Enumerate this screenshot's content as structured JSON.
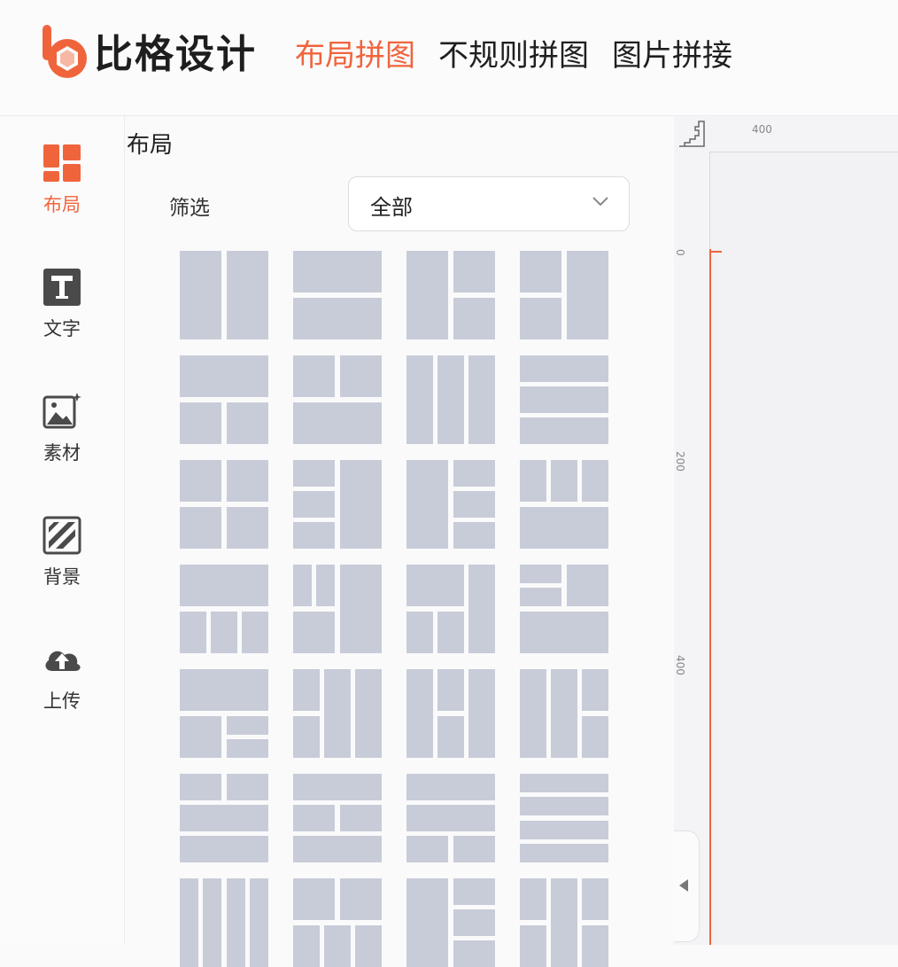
{
  "header": {
    "brand": "比格设计",
    "tabs": [
      {
        "label": "布局拼图",
        "active": true
      },
      {
        "label": "不规则拼图",
        "active": false
      },
      {
        "label": "图片拼接",
        "active": false
      }
    ]
  },
  "sidebar": {
    "items": [
      {
        "label": "布局",
        "icon": "layout-icon",
        "active": true
      },
      {
        "label": "文字",
        "icon": "text-icon",
        "active": false
      },
      {
        "label": "素材",
        "icon": "image-icon",
        "active": false
      },
      {
        "label": "背景",
        "icon": "background-icon",
        "active": false
      },
      {
        "label": "上传",
        "icon": "upload-icon",
        "active": false
      }
    ]
  },
  "panel": {
    "title": "布局",
    "filter_label": "筛选",
    "filter_value": "全部"
  },
  "canvas": {
    "ruler_top_label": "400",
    "ruler_left_labels": [
      "0",
      "200",
      "400"
    ]
  },
  "colors": {
    "accent": "#f0643c",
    "tile": "#c8ccd8"
  }
}
